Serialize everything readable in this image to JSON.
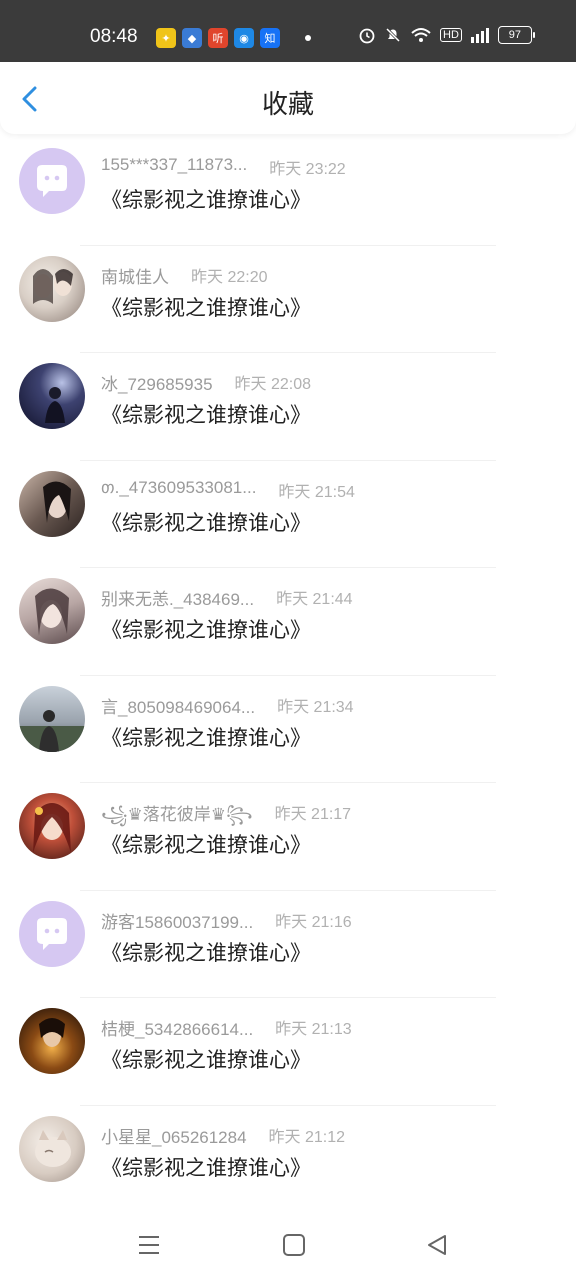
{
  "status_bar": {
    "time": "08:48",
    "battery": "97",
    "network": "HD",
    "signal": "4G",
    "apps": [
      {
        "icon": "trophy-app-icon",
        "glyph": "✦",
        "color": "#f0c419"
      },
      {
        "icon": "paw-app-icon",
        "glyph": "◆",
        "color": "#3a7bd5"
      },
      {
        "icon": "ting-app-icon",
        "glyph": "听",
        "color": "#e0452c"
      },
      {
        "icon": "circle-app-icon",
        "glyph": "◉",
        "color": "#1e88e5"
      },
      {
        "icon": "zhihu-app-icon",
        "glyph": "知",
        "color": "#1772f6"
      }
    ]
  },
  "header": {
    "title": "收藏"
  },
  "items": [
    {
      "name": "155***337_11873...",
      "time": "昨天 23:22",
      "book": "《综影视之谁撩谁心》",
      "avatar": "default"
    },
    {
      "name": "南城佳人",
      "time": "昨天 22:20",
      "book": "《综影视之谁撩谁心》",
      "avatar": "photo1"
    },
    {
      "name": "冰_729685935",
      "time": "昨天 22:08",
      "book": "《综影视之谁撩谁心》",
      "avatar": "photo2"
    },
    {
      "name": " თ._473609533081...",
      "time": "昨天 21:54",
      "book": "《综影视之谁撩谁心》",
      "avatar": "photo3"
    },
    {
      "name": "别来无恙._438469...",
      "time": "昨天 21:44",
      "book": "《综影视之谁撩谁心》",
      "avatar": "photo4"
    },
    {
      "name": "言_805098469064...",
      "time": "昨天 21:34",
      "book": "《综影视之谁撩谁心》",
      "avatar": "photo5"
    },
    {
      "name": "꧁♛落花彼岸♛꧂",
      "time": "昨天 21:17",
      "book": "《综影视之谁撩谁心》",
      "avatar": "photo6"
    },
    {
      "name": "游客15860037199...",
      "time": "昨天 21:16",
      "book": "《综影视之谁撩谁心》",
      "avatar": "default"
    },
    {
      "name": "桔梗_5342866614...",
      "time": "昨天 21:13",
      "book": "《综影视之谁撩谁心》",
      "avatar": "photo7"
    },
    {
      "name": "小星星_065261284",
      "time": "昨天 21:12",
      "book": "《综影视之谁撩谁心》",
      "avatar": "photo8"
    }
  ],
  "colors": {
    "accent": "#2f8fe0",
    "default_avatar_bg": "#d6c8f2",
    "default_avatar_fg": "#ffffff"
  },
  "navbar": {
    "buttons": [
      "menu-icon",
      "home-icon",
      "back-triangle-icon"
    ]
  }
}
